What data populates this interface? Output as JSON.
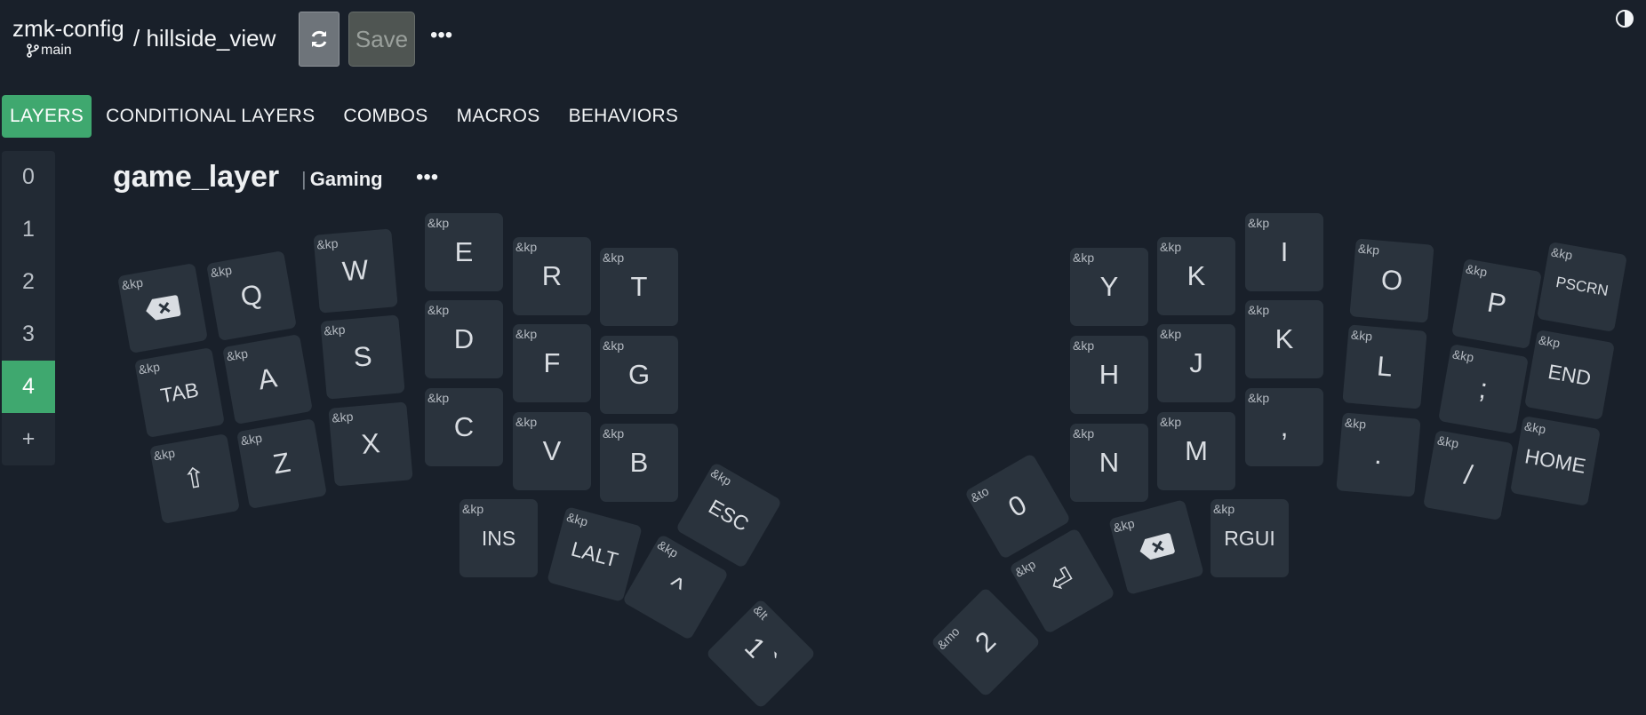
{
  "header": {
    "repo": "zmk-config",
    "branch": "main",
    "separator_file": "/ hillside_view",
    "save_label": "Save",
    "more": "•••"
  },
  "tabs": [
    {
      "label": "LAYERS",
      "active": true
    },
    {
      "label": "CONDITIONAL LAYERS",
      "active": false
    },
    {
      "label": "COMBOS",
      "active": false
    },
    {
      "label": "MACROS",
      "active": false
    },
    {
      "label": "BEHAVIORS",
      "active": false
    }
  ],
  "layers": {
    "items": [
      "0",
      "1",
      "2",
      "3",
      "4"
    ],
    "active_index": 4,
    "add": "+"
  },
  "layer": {
    "name": "game_layer",
    "label": "Gaming",
    "more": "•••"
  },
  "keys": [
    {
      "beh": "&kp",
      "label": "",
      "icon": "backspace-icon"
    },
    {
      "beh": "&kp",
      "label": "Q"
    },
    {
      "beh": "&kp",
      "label": "W"
    },
    {
      "beh": "&kp",
      "label": "E"
    },
    {
      "beh": "&kp",
      "label": "R"
    },
    {
      "beh": "&kp",
      "label": "T"
    },
    {
      "beh": "&kp",
      "label": "TAB"
    },
    {
      "beh": "&kp",
      "label": "A"
    },
    {
      "beh": "&kp",
      "label": "S"
    },
    {
      "beh": "&kp",
      "label": "D"
    },
    {
      "beh": "&kp",
      "label": "F"
    },
    {
      "beh": "&kp",
      "label": "G"
    },
    {
      "beh": "&kp",
      "label": "⇧"
    },
    {
      "beh": "&kp",
      "label": "Z"
    },
    {
      "beh": "&kp",
      "label": "X"
    },
    {
      "beh": "&kp",
      "label": "C"
    },
    {
      "beh": "&kp",
      "label": "V"
    },
    {
      "beh": "&kp",
      "label": "B"
    },
    {
      "beh": "&kp",
      "label": "INS"
    },
    {
      "beh": "&kp",
      "label": "LALT"
    },
    {
      "beh": "&kp",
      "label": "^"
    },
    {
      "beh": "&kp",
      "label": "ESC"
    },
    {
      "beh": "&lt",
      "label": "1 `"
    },
    {
      "beh": "&kp",
      "label": "Y"
    },
    {
      "beh": "&kp",
      "label": "K"
    },
    {
      "beh": "&kp",
      "label": "I"
    },
    {
      "beh": "&kp",
      "label": "O"
    },
    {
      "beh": "&kp",
      "label": "P"
    },
    {
      "beh": "&kp",
      "label": "PSCRN"
    },
    {
      "beh": "&kp",
      "label": "H"
    },
    {
      "beh": "&kp",
      "label": "J"
    },
    {
      "beh": "&kp",
      "label": "K"
    },
    {
      "beh": "&kp",
      "label": "L"
    },
    {
      "beh": "&kp",
      "label": ";"
    },
    {
      "beh": "&kp",
      "label": "END"
    },
    {
      "beh": "&kp",
      "label": "N"
    },
    {
      "beh": "&kp",
      "label": "M"
    },
    {
      "beh": "&kp",
      "label": ","
    },
    {
      "beh": "&kp",
      "label": "."
    },
    {
      "beh": "&kp",
      "label": "/"
    },
    {
      "beh": "&kp",
      "label": "HOME"
    },
    {
      "beh": "&to",
      "label": "0"
    },
    {
      "beh": "&kp",
      "label": "",
      "icon": "backspace-icon"
    },
    {
      "beh": "&kp",
      "label": "RGUI"
    },
    {
      "beh": "&kp",
      "label": "⏎"
    },
    {
      "beh": "&mo",
      "label": "2"
    }
  ],
  "colors": {
    "background": "#19202a",
    "key": "#2a333d",
    "accent": "#3fa86f"
  }
}
